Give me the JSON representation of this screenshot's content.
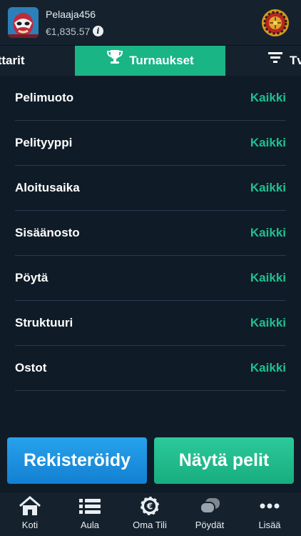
{
  "header": {
    "username": "Pelaaja456",
    "balance": "€1,835.57",
    "info_icon": "info-icon",
    "avatar": "luchador-avatar",
    "roulette_icon": "roulette-wheel-icon"
  },
  "tabs": [
    {
      "label": "ittarit",
      "active": false
    },
    {
      "label": "Turnaukset",
      "active": true,
      "icon": "trophy-icon"
    },
    {
      "label": "Tv",
      "active": false,
      "icon": "filter-icon"
    }
  ],
  "filters": [
    {
      "label": "Pelimuoto",
      "value": "Kaikki"
    },
    {
      "label": "Pelityyppi",
      "value": "Kaikki"
    },
    {
      "label": "Aloitusaika",
      "value": "Kaikki"
    },
    {
      "label": "Sisäänosto",
      "value": "Kaikki"
    },
    {
      "label": "Pöytä",
      "value": "Kaikki"
    },
    {
      "label": "Struktuuri",
      "value": "Kaikki"
    },
    {
      "label": "Ostot",
      "value": "Kaikki"
    }
  ],
  "actions": {
    "register": "Rekisteröidy",
    "show_games": "Näytä pelit"
  },
  "nav": [
    {
      "label": "Koti",
      "icon": "home-icon"
    },
    {
      "label": "Aula",
      "icon": "list-icon"
    },
    {
      "label": "Oma Tili",
      "icon": "euro-chip-icon"
    },
    {
      "label": "Pöydät",
      "icon": "tables-icon"
    },
    {
      "label": "Lisää",
      "icon": "more-icon"
    }
  ],
  "colors": {
    "accent_green": "#1fc08f",
    "button_blue": "#1c8fe0",
    "background": "#0f1c28"
  }
}
